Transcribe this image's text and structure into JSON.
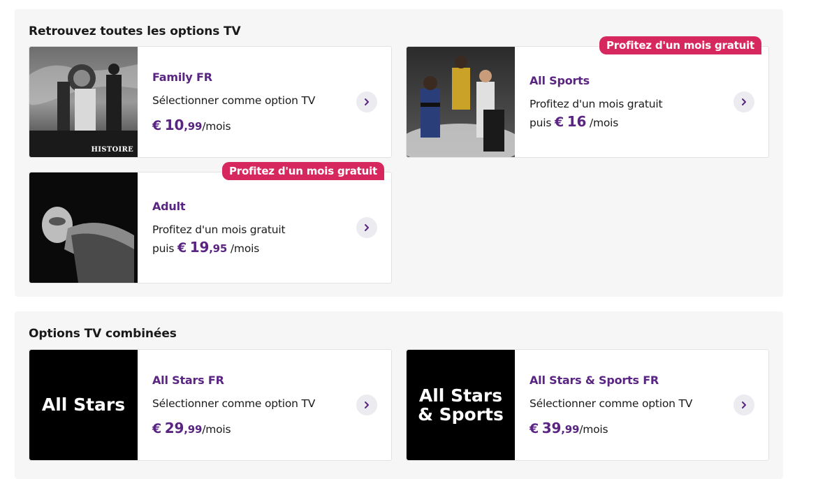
{
  "sections": [
    {
      "title": "Retrouvez toutes les options TV",
      "cards": [
        {
          "name": "Family FR",
          "subtitle": "Sélectionner comme option TV",
          "price_prefix": "",
          "price_currency": "€",
          "price_int": "10",
          "price_dec": ",99",
          "price_unit": "/mois",
          "badge": "",
          "thumb_label": "HISTOIRE"
        },
        {
          "name": "All Sports",
          "subtitle": "Profitez d'un mois gratuit",
          "price_prefix": "puis",
          "price_currency": "€",
          "price_int": "16",
          "price_dec": "",
          "price_unit": "/mois",
          "badge": "Profitez d'un mois gratuit"
        },
        {
          "name": "Adult",
          "subtitle": "Profitez d'un mois gratuit",
          "price_prefix": "puis",
          "price_currency": "€",
          "price_int": "19",
          "price_dec": ",95",
          "price_unit": "/mois",
          "badge": "Profitez d'un mois gratuit"
        }
      ]
    },
    {
      "title": "Options TV combinées",
      "cards": [
        {
          "name": "All Stars FR",
          "subtitle": "Sélectionner comme option TV",
          "price_prefix": "",
          "price_currency": "€",
          "price_int": "29",
          "price_dec": ",99",
          "price_unit": "/mois",
          "badge": "",
          "thumb_label": "All Stars"
        },
        {
          "name": "All Stars & Sports FR",
          "subtitle": "Sélectionner comme option TV",
          "price_prefix": "",
          "price_currency": "€",
          "price_int": "39",
          "price_dec": ",99",
          "price_unit": "/mois",
          "badge": "",
          "thumb_label_1": "All Stars",
          "thumb_label_2": "& Sports"
        }
      ]
    }
  ],
  "icons": {
    "arrow": "chevron-right-icon"
  },
  "colors": {
    "accent": "#5a2582",
    "badge": "#d6275f",
    "panel": "#f6f6f6",
    "arrow_bg": "#ececf0"
  }
}
